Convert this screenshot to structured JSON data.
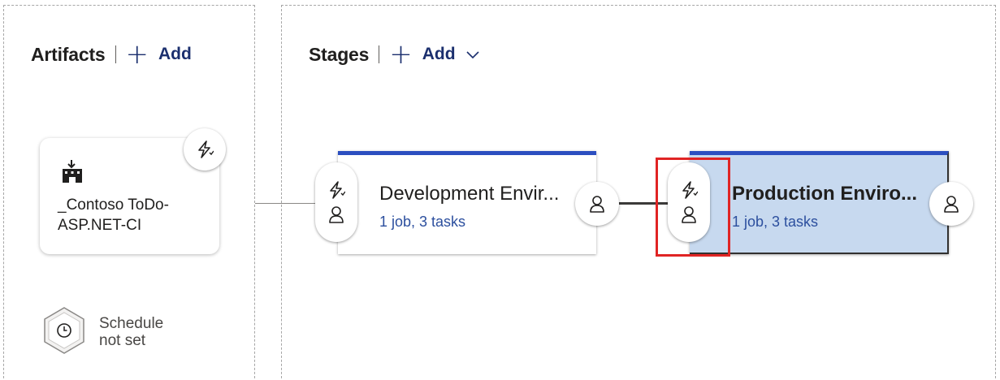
{
  "artifacts": {
    "title": "Artifacts",
    "add_label": "Add",
    "card": {
      "name_line1": "_Contoso ToDo-",
      "name_line2": "ASP.NET-CI"
    },
    "schedule": {
      "line1": "Schedule",
      "line2": "not set"
    }
  },
  "stages": {
    "title": "Stages",
    "add_label": "Add",
    "items": [
      {
        "name": "Development Envir...",
        "summary": "1 job, 3 tasks",
        "selected": false
      },
      {
        "name": "Production Enviro...",
        "summary": "1 job, 3 tasks",
        "selected": true
      }
    ]
  },
  "colors": {
    "accent": "#2c4fc0",
    "link": "#2c4f9e",
    "selected_stage_bg": "#c7d9ef",
    "highlight": "#e02424"
  },
  "icons": {
    "trigger": "lightning-icon",
    "approver": "person-icon",
    "artifact": "build-artifact-icon",
    "schedule": "clock-icon"
  }
}
